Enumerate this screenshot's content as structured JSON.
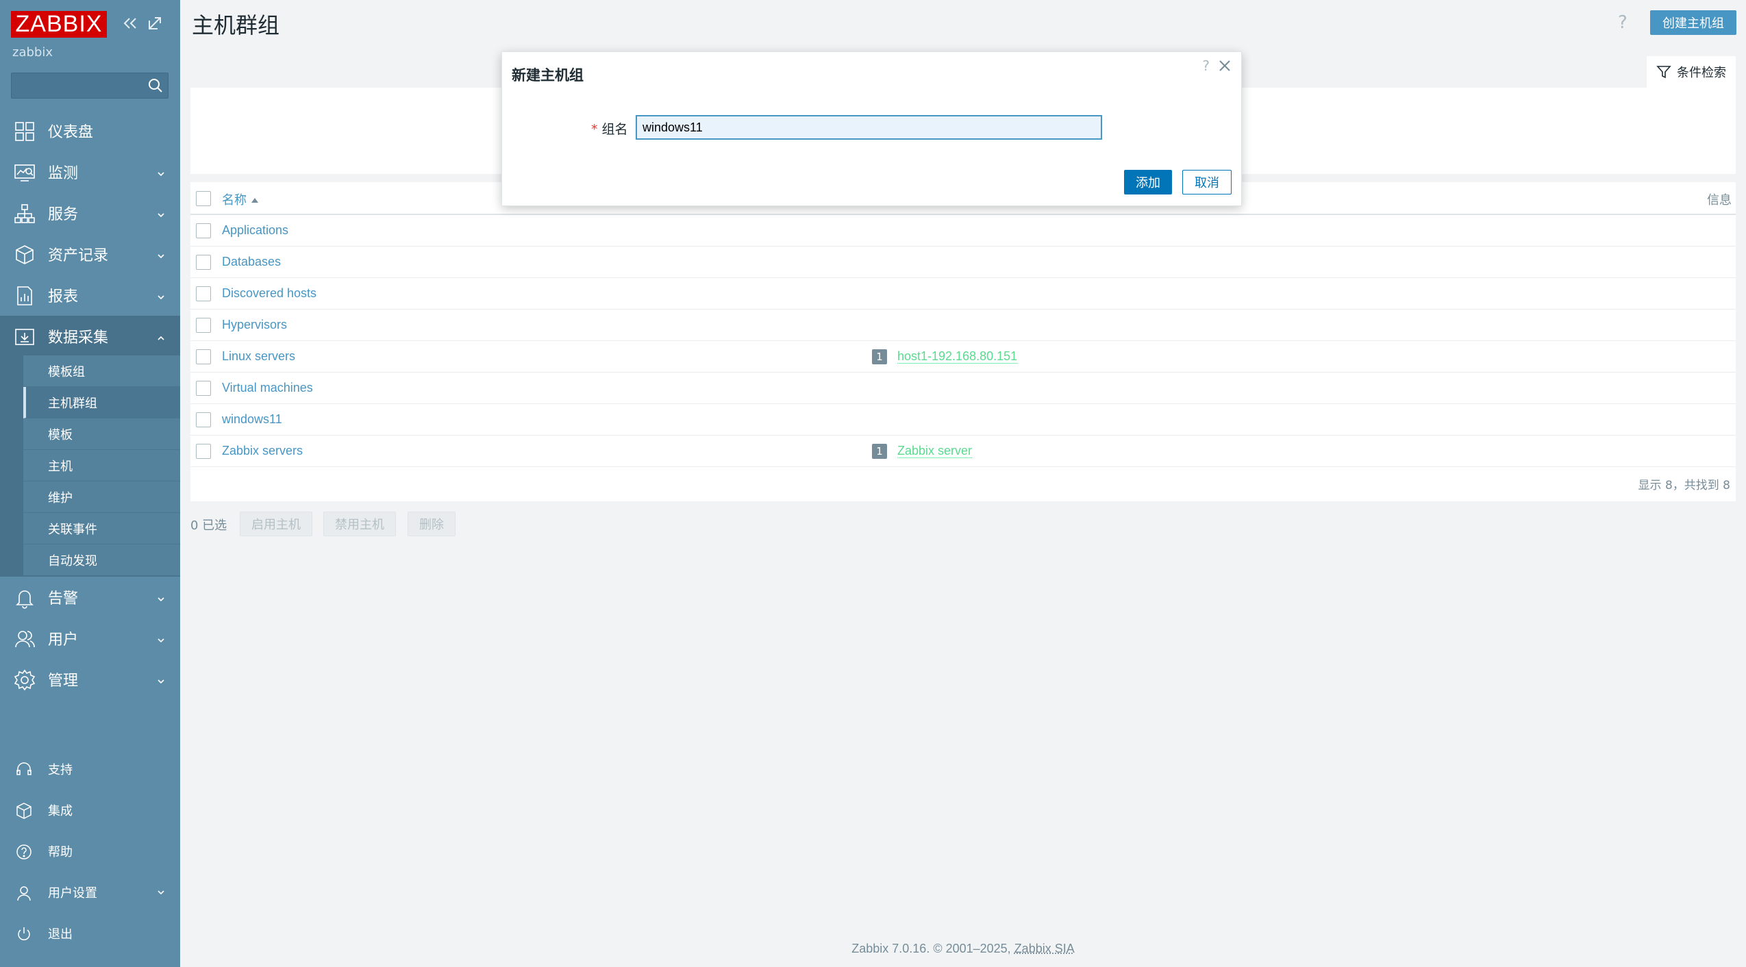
{
  "sidebar": {
    "logo": "ZABBIX",
    "user": "zabbix",
    "search": {
      "value": "",
      "placeholder": ""
    },
    "nav": [
      {
        "label": "仪表盘",
        "icon": "dashboard-icon"
      },
      {
        "label": "监测",
        "icon": "monitoring-icon"
      },
      {
        "label": "服务",
        "icon": "services-icon"
      },
      {
        "label": "资产记录",
        "icon": "inventory-icon"
      },
      {
        "label": "报表",
        "icon": "reports-icon"
      },
      {
        "label": "数据采集",
        "icon": "data-collection-icon"
      },
      {
        "label": "告警",
        "icon": "alerts-icon"
      },
      {
        "label": "用户",
        "icon": "users-icon"
      },
      {
        "label": "管理",
        "icon": "administration-icon"
      }
    ],
    "subnav": [
      "模板组",
      "主机群组",
      "模板",
      "主机",
      "维护",
      "关联事件",
      "自动发现"
    ],
    "active_subnav": "主机群组",
    "bottom": [
      {
        "label": "支持",
        "icon": "support-icon"
      },
      {
        "label": "集成",
        "icon": "integrations-icon"
      },
      {
        "label": "帮助",
        "icon": "help-icon"
      },
      {
        "label": "用户设置",
        "icon": "user-settings-icon"
      },
      {
        "label": "退出",
        "icon": "signout-icon"
      }
    ]
  },
  "header": {
    "title": "主机群组",
    "help": "?",
    "create_button": "创建主机组"
  },
  "filter": {
    "tab_label": "条件检索"
  },
  "table": {
    "col_name": "名称",
    "col_info": "信息",
    "rows": [
      {
        "name": "Applications",
        "count": "",
        "host": ""
      },
      {
        "name": "Databases",
        "count": "",
        "host": ""
      },
      {
        "name": "Discovered hosts",
        "count": "",
        "host": ""
      },
      {
        "name": "Hypervisors",
        "count": "",
        "host": ""
      },
      {
        "name": "Linux servers",
        "count": "1",
        "host": "host1-192.168.80.151"
      },
      {
        "name": "Virtual machines",
        "count": "",
        "host": ""
      },
      {
        "name": "windows11",
        "count": "",
        "host": ""
      },
      {
        "name": "Zabbix servers",
        "count": "1",
        "host": "Zabbix server"
      }
    ],
    "footer": "显示 8，共找到 8"
  },
  "actions": {
    "selected": "0 已选",
    "enable": "启用主机",
    "disable": "禁用主机",
    "delete": "删除"
  },
  "footer": {
    "text": "Zabbix 7.0.16. © 2001–2025, ",
    "company": "Zabbix SIA"
  },
  "dialog": {
    "title": "新建主机组",
    "help": "?",
    "field_label": "组名",
    "field_value": "windows11",
    "add_button": "添加",
    "cancel_button": "取消"
  },
  "colors": {
    "sidebar": "#5d8ca8",
    "accent": "#0275b8",
    "link": "#4796c4",
    "host_link": "#59db8f",
    "logo": "#d40000"
  }
}
